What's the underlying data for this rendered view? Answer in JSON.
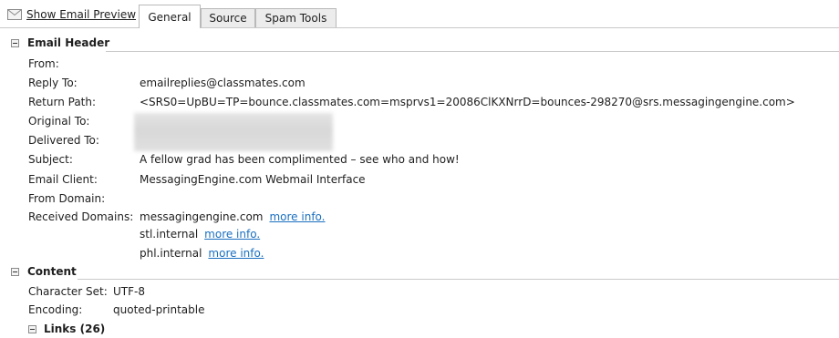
{
  "toolbar": {
    "preview_label": "Show Email Preview",
    "tabs": [
      {
        "label": "General",
        "active": true
      },
      {
        "label": "Source",
        "active": false
      },
      {
        "label": "Spam Tools",
        "active": false
      }
    ]
  },
  "email_header": {
    "title": "Email Header",
    "fields": {
      "from": {
        "label": "From:",
        "value": ""
      },
      "reply_to": {
        "label": "Reply To:",
        "value": "emailreplies@classmates.com"
      },
      "return_path": {
        "label": "Return Path:",
        "value": "<SRS0=UpBU=TP=bounce.classmates.com=msprvs1=20086ClKXNrrD=bounces-298270@srs.messagingengine.com>"
      },
      "original_to": {
        "label": "Original To:",
        "value": ""
      },
      "delivered_to": {
        "label": "Delivered To:",
        "value": ""
      },
      "subject": {
        "label": "Subject:",
        "value": "A fellow grad has been complimented – see who and how!"
      },
      "email_client": {
        "label": "Email Client:",
        "value": "MessagingEngine.com Webmail Interface"
      },
      "from_domain": {
        "label": "From Domain:",
        "value": ""
      },
      "received_domains": {
        "label": "Received Domains:"
      }
    },
    "received_domains": [
      {
        "domain": "messagingengine.com",
        "link": "more info."
      },
      {
        "domain": "stl.internal",
        "link": "more info."
      },
      {
        "domain": "phl.internal",
        "link": "more info."
      }
    ]
  },
  "content": {
    "title": "Content",
    "fields": {
      "charset": {
        "label": "Character Set:",
        "value": "UTF-8"
      },
      "encoding": {
        "label": "Encoding:",
        "value": "quoted-printable"
      }
    }
  },
  "links": {
    "title": "Links (26)"
  },
  "colors": {
    "link": "#1a6fc0",
    "divider": "#c9c9c9",
    "tab_inactive": "#ececec"
  }
}
